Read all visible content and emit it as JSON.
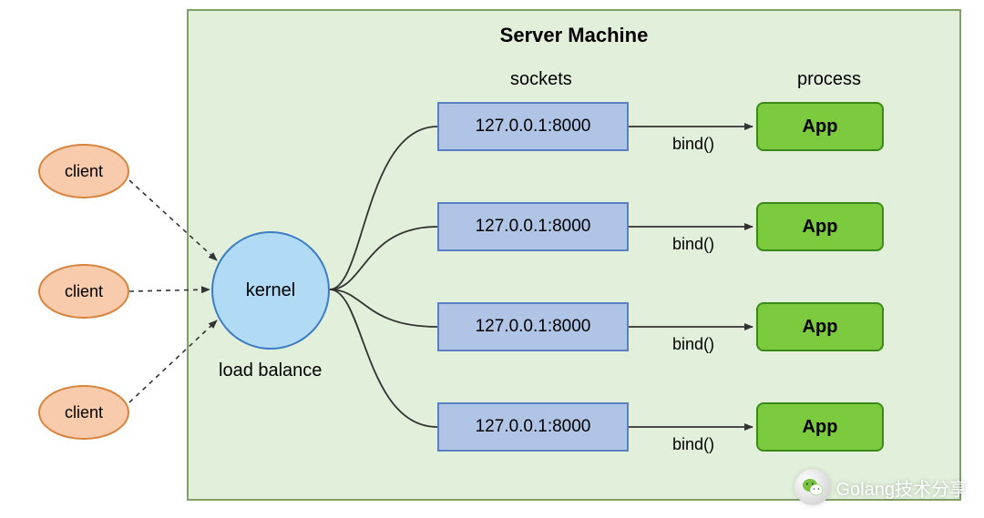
{
  "server": {
    "title": "Server Machine",
    "sockets_label": "sockets",
    "process_label": "process",
    "load_balance_label": "load balance",
    "kernel_label": "kernel"
  },
  "clients": [
    {
      "label": "client"
    },
    {
      "label": "client"
    },
    {
      "label": "client"
    }
  ],
  "rows": [
    {
      "socket": "127.0.0.1:8000",
      "bind": "bind()",
      "app": "App"
    },
    {
      "socket": "127.0.0.1:8000",
      "bind": "bind()",
      "app": "App"
    },
    {
      "socket": "127.0.0.1:8000",
      "bind": "bind()",
      "app": "App"
    },
    {
      "socket": "127.0.0.1:8000",
      "bind": "bind()",
      "app": "App"
    }
  ],
  "watermark": {
    "text": "Golang技术分享"
  }
}
